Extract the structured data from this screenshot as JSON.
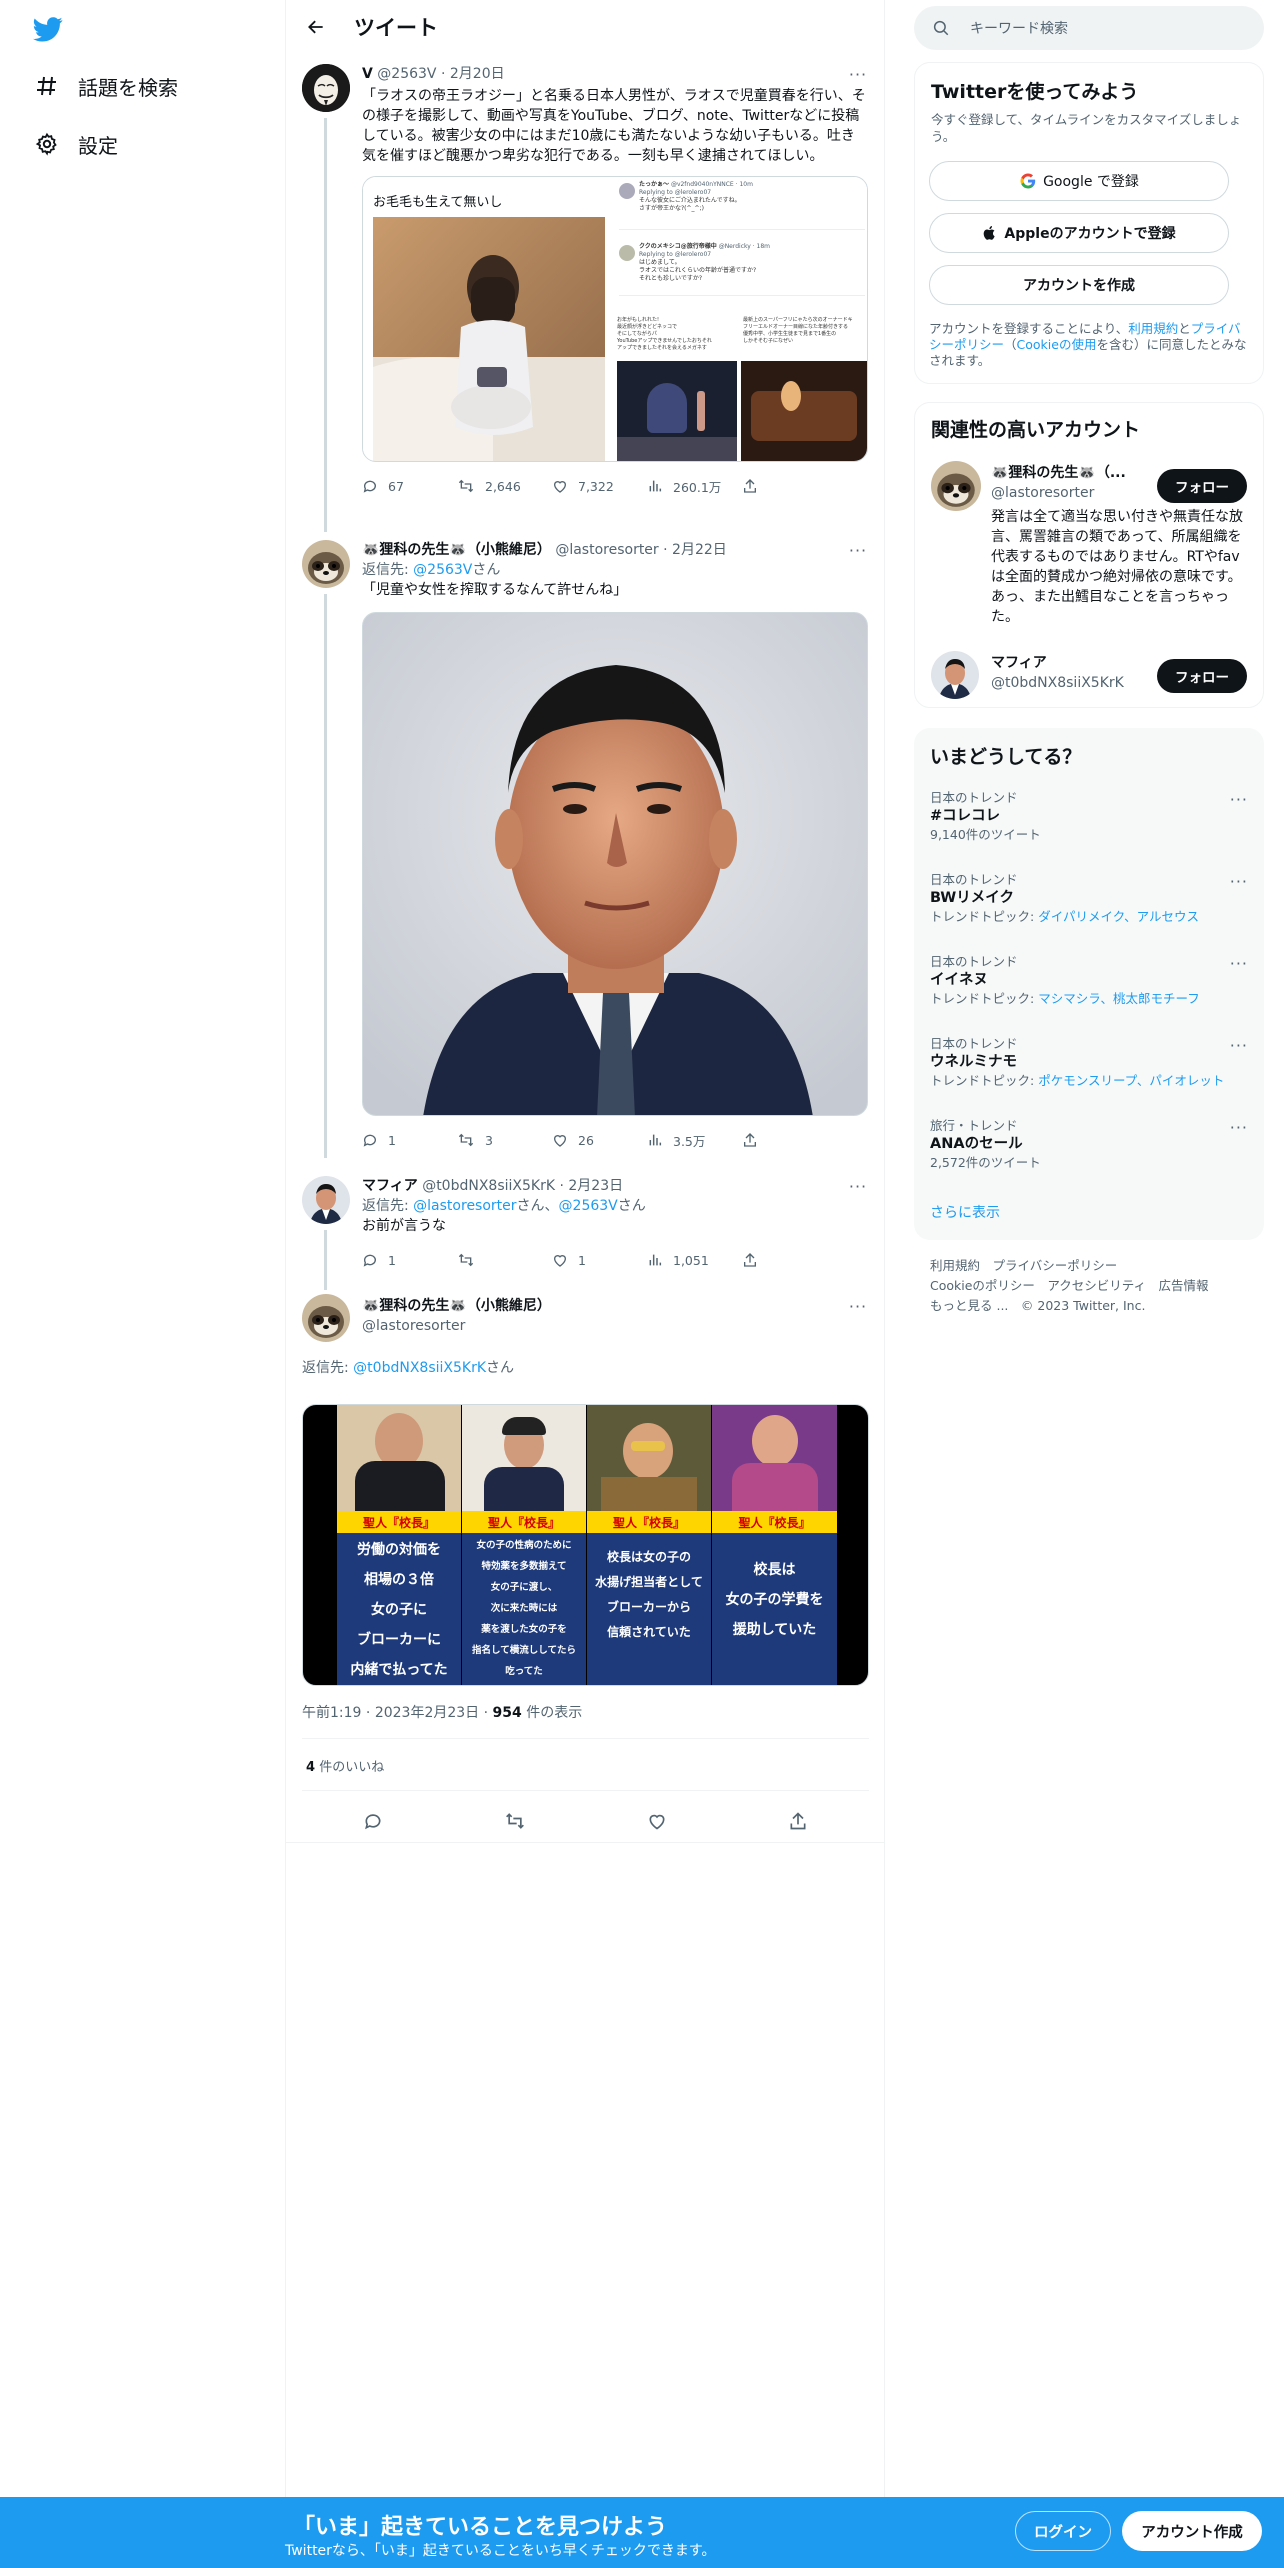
{
  "nav": {
    "items": [
      {
        "icon": "hashtag-icon",
        "label": "話題を検索"
      },
      {
        "icon": "gear-icon",
        "label": "設定"
      }
    ]
  },
  "header": {
    "title": "ツイート"
  },
  "tweet1": {
    "name": "V",
    "handle": "@2563V",
    "date": "2月20日",
    "text": "「ラオスの帝王ラオジー」と名乗る日本人男性が、ラオスで児童買春を行い、その様子を撮影して、動画や写真をYouTube、ブログ、note、Twitterなどに投稿している。被害少女の中にはまだ10歳にも満たないような幼い子もいる。吐き気を催すほど醜悪かつ卑劣な犯行である。一刻も早く逮捕されてほしい。",
    "media_caption": "お毛毛も生えて無いし",
    "embed": [
      {
        "name": "たっかぁ〜",
        "handle": "@v2fnd9040nYNNCE · 10m",
        "reply": "Replying to @lerolero07",
        "lines": [
          "そんな彼女にご介込まれたんですね。",
          "さすが帝王かな?(^_^;)"
        ]
      },
      {
        "name": "ククのメキシコ@旅行帝様中",
        "handle": "@Nerdicky · 18m",
        "reply": "Replying to @lerolero07",
        "lines": [
          "はじめまして。",
          "ラオスではこれくらいの年齢が普通ですか?",
          "それとも珍しいですか?"
        ]
      }
    ],
    "embed_small_left": [
      "お年がもしれれた!",
      "最近顔が浮きどどネッコで",
      "そにしてながらパ",
      "YouTubeアップできませんでしたおちそれ",
      "アップできましたそれを会えるメガネす"
    ],
    "embed_small_right": [
      "最新上のスーパーフリにゃたら次のオーナードキ",
      "フリーエルドオーナー目線になた年齢付きする",
      "優秀中学、小学生生徒まで見まで1番生の",
      "しかそそむ子になぜい"
    ],
    "replies": "67",
    "retweets": "2,646",
    "likes": "7,322",
    "views": "260.1万"
  },
  "tweet2": {
    "name": "🦝狸科の先生🦝（小熊維尼）",
    "handle": "@lastoresorter",
    "date": "2月22日",
    "reply_prefix": "返信先: ",
    "reply_to": "@2563V",
    "reply_suffix": "さん",
    "text": "「児童や女性を搾取するなんて許せんね」",
    "replies": "1",
    "retweets": "3",
    "likes": "26",
    "views": "3.5万"
  },
  "tweet3": {
    "name": "マフィア",
    "handle": "@t0bdNX8siiX5KrK",
    "date": "2月23日",
    "reply_prefix": "返信先: ",
    "reply_to_1": "@lastoresorter",
    "reply_mid": "さん、",
    "reply_to_2": "@2563V",
    "reply_suffix": "さん",
    "text": "お前が言うな",
    "replies": "1",
    "likes": "1",
    "views": "1,051"
  },
  "main_tweet": {
    "name": "🦝狸科の先生🦝（小熊維尼）",
    "handle": "@lastoresorter",
    "reply_prefix": "返信先: ",
    "reply_to": "@t0bdNX8siiX5KrK",
    "reply_suffix": "さん",
    "panels": [
      {
        "tag": "聖人『校長』",
        "lines": [
          "労働の対価を",
          "相場の３倍",
          "女の子に",
          "ブローカーに",
          "内緒で払ってた"
        ]
      },
      {
        "tag": "聖人『校長』",
        "lines": [
          "女の子の性病のために",
          "特効薬を多数揃えて",
          "女の子に渡し、",
          "次に来た時には",
          "薬を渡した女の子を",
          "指名して横流ししてたら",
          "吃ってた"
        ]
      },
      {
        "tag": "聖人『校長』",
        "lines": [
          "校長は女の子の",
          "水揚げ担当者として",
          "ブローカーから",
          "信頼されていた"
        ]
      },
      {
        "tag": "聖人『校長』",
        "lines": [
          "校長は",
          "女の子の学費を",
          "援助していた"
        ]
      }
    ],
    "time": "午前1:19",
    "date": "2023年2月23日",
    "views_num": "954",
    "views_label": "件の表示",
    "likes_num": "4",
    "likes_label": "件のいいね"
  },
  "search": {
    "placeholder": "キーワード検索"
  },
  "signup_panel": {
    "title": "Twitterを使ってみよう",
    "subtitle": "今すぐ登録して、タイムラインをカスタマイズしましょう。",
    "google": "Google で登録",
    "apple": "Appleのアカウントで登録",
    "create": "アカウントを作成",
    "legal_1": "アカウントを登録することにより、",
    "legal_terms": "利用規約",
    "legal_2": "と",
    "legal_privacy": "プライバシーポリシー",
    "legal_3": "（",
    "legal_cookie": "Cookieの使用",
    "legal_4": "を含む）に同意したとみなされます。"
  },
  "related": {
    "title": "関連性の高いアカウント",
    "accounts": [
      {
        "name": "🦝狸科の先生🦝（...",
        "handle": "@lastoresorter",
        "bio": "発言は全て適当な思い付きや無責任な放言、罵詈雑言の類であって、所属組織を代表するものではありません。RTやfavは全面的賛成かつ絶対帰依の意味です。 あっ、また出鱈目なことを言っちゃった。",
        "follow": "フォロー"
      },
      {
        "name": "マフィア",
        "handle": "@t0bdNX8siiX5KrK",
        "follow": "フォロー"
      }
    ]
  },
  "trends": {
    "title": "いまどうしてる？",
    "items": [
      {
        "meta": "日本のトレンド",
        "name": "#コレコレ",
        "sub": "9,140件のツイート"
      },
      {
        "meta": "日本のトレンド",
        "name": "BWリメイク",
        "sub_prefix": "トレンドトピック: ",
        "links": "ダイパリメイク、アルセウス"
      },
      {
        "meta": "日本のトレンド",
        "name": "イイネヌ",
        "sub_prefix": "トレンドトピック: ",
        "links": "マシマシラ、桃太郎モチーフ"
      },
      {
        "meta": "日本のトレンド",
        "name": "ウネルミナモ",
        "sub_prefix": "トレンドトピック: ",
        "links": "ポケモンスリープ、パイオレット"
      },
      {
        "meta": "旅行・トレンド",
        "name": "ANAのセール",
        "sub": "2,572件のツイート"
      }
    ],
    "show_more": "さらに表示"
  },
  "footer": {
    "line1": "利用規約　プライバシーポリシー",
    "line2": "Cookieのポリシー　アクセシビリティ　広告情報",
    "line3": "もっと見る ...　© 2023 Twitter, Inc."
  },
  "banner": {
    "title": "「いま」起きていることを見つけよう",
    "subtitle": "Twitterなら、「いま」起きていることをいち早くチェックできます。",
    "login": "ログイン",
    "signup": "アカウント作成"
  },
  "colors": {
    "accent": "#1d9bf0",
    "text": "#0f1419",
    "muted": "#536471"
  }
}
